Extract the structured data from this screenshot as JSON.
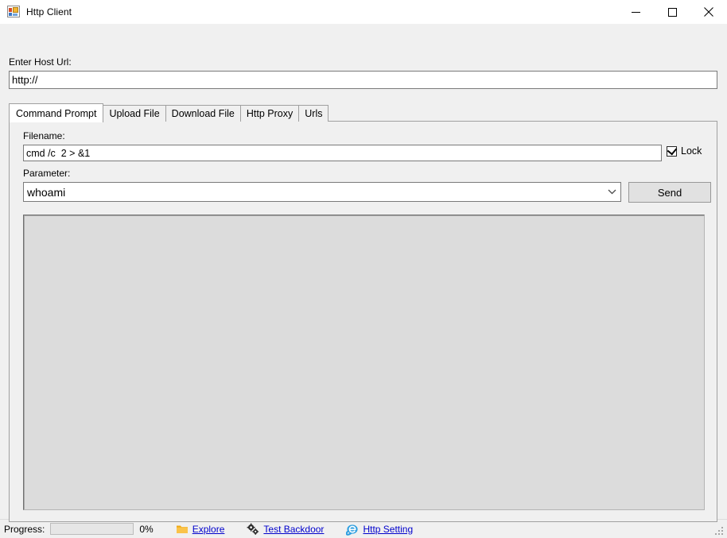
{
  "window": {
    "title": "Http Client",
    "icon": "form-window-icon",
    "controls": {
      "minimize": "minimize-button",
      "maximize": "maximize-button",
      "close": "close-button"
    }
  },
  "host": {
    "label": "Enter Host Url:",
    "value": "http://",
    "placeholder": ""
  },
  "tabs": [
    {
      "label": "Command Prompt",
      "active": true
    },
    {
      "label": "Upload File",
      "active": false
    },
    {
      "label": "Download File",
      "active": false
    },
    {
      "label": "Http Proxy",
      "active": false
    },
    {
      "label": "Urls",
      "active": false
    }
  ],
  "command_prompt": {
    "filename_label": "Filename:",
    "filename_value": "cmd /c  2 > &1",
    "lock_label": "Lock",
    "lock_checked": true,
    "parameter_label": "Parameter:",
    "parameter_value": "whoami",
    "send_label": "Send",
    "output_value": ""
  },
  "statusbar": {
    "progress_label": "Progress:",
    "progress_percent": "0%",
    "progress_value": 0,
    "links": [
      {
        "label": "Explore",
        "icon": "folder-icon"
      },
      {
        "label": "Test Backdoor",
        "icon": "gears-icon"
      },
      {
        "label": "Http Setting",
        "icon": "internet-explorer-icon"
      }
    ]
  },
  "colors": {
    "window_background": "#f0f0f0",
    "titlebar_background": "#ffffff",
    "link": "#0000cc",
    "folder_icon": "#f5b31b",
    "ie_icon": "#2e9fe0",
    "output_background": "#dcdcdc",
    "button_face": "#e1e1e1"
  }
}
